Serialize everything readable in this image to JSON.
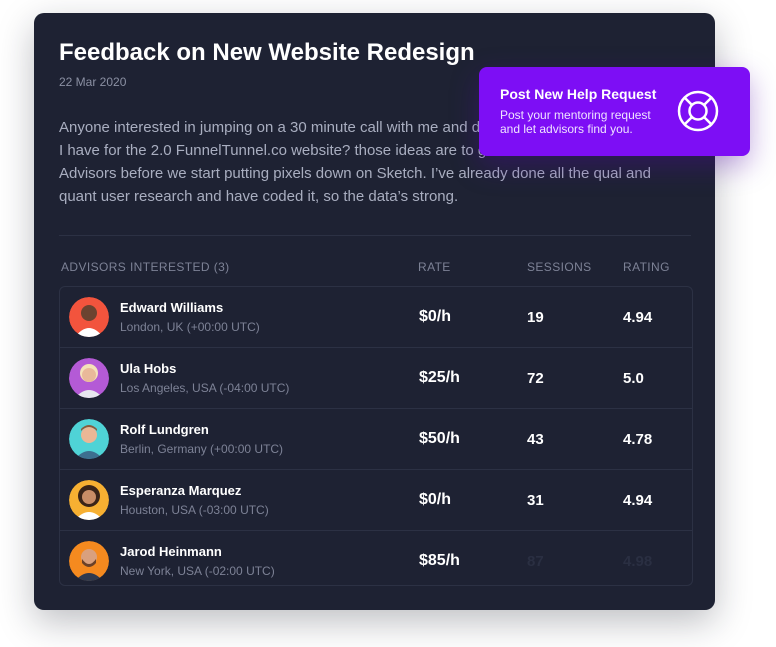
{
  "post": {
    "title": "Feedback on New Website Redesign",
    "date": "22 Mar 2020",
    "description": "Anyone interested in jumping on a 30 minute call with me and discussing some general ideas I have for the 2.0 FunnelTunnel.co website? those ideas are to get that feedback from Vulk Advisors before we start putting pixels down on Sketch. I’ve already done all the qual and quant user research and have coded it, so the data’s strong."
  },
  "table": {
    "headers": {
      "advisors": "ADVISORS INTERESTED (3)",
      "rate": "RATE",
      "sessions": "SESSIONS",
      "rating": "RATING"
    },
    "rows": [
      {
        "name": "Edward Williams",
        "location": "London, UK (+00:00 UTC)",
        "rate": "$0/h",
        "sessions": "19",
        "rating": "4.94",
        "avatar_color": "#f2543d"
      },
      {
        "name": "Ula Hobs",
        "location": "Los Angeles, USA (-04:00 UTC)",
        "rate": "$25/h",
        "sessions": "72",
        "rating": "5.0",
        "avatar_color": "#b45ad6"
      },
      {
        "name": "Rolf Lundgren",
        "location": "Berlin, Germany (+00:00 UTC)",
        "rate": "$50/h",
        "sessions": "43",
        "rating": "4.78",
        "avatar_color": "#4fd3d6"
      },
      {
        "name": "Esperanza Marquez",
        "location": "Houston, USA (-03:00 UTC)",
        "rate": "$0/h",
        "sessions": "31",
        "rating": "4.94",
        "avatar_color": "#f7b032"
      },
      {
        "name": "Jarod Heinmann",
        "location": "New York, USA (-02:00 UTC)",
        "rate": "$85/h",
        "sessions": "87",
        "rating": "4.98",
        "avatar_color": "#f58a1f"
      }
    ]
  },
  "popup": {
    "title": "Post New Help Request",
    "text": "Post your mentoring request and let advisors find you.",
    "icon": "lifebuoy-icon"
  },
  "colors": {
    "card_background": "#1e2233",
    "accent": "#7d0ef5"
  }
}
